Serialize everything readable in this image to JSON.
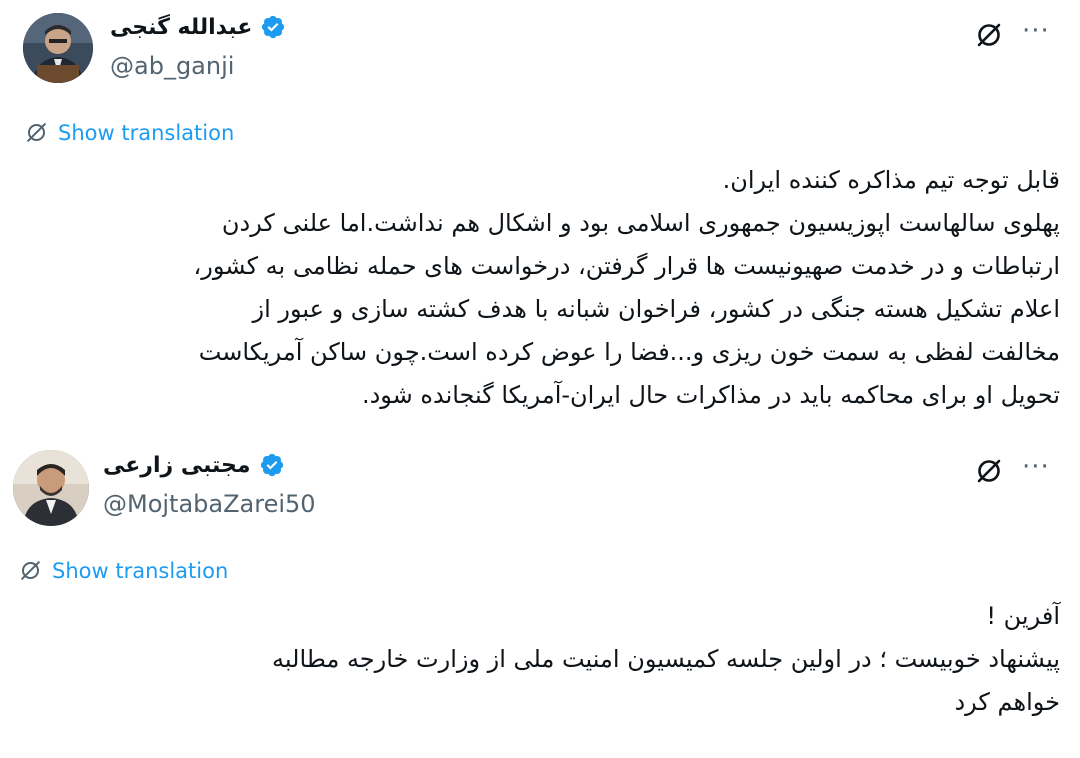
{
  "tweets": [
    {
      "display_name": "عبدالله گنجی",
      "handle": "@ab_ganji",
      "show_translation": "Show translation",
      "more_label": "···",
      "text_lines": [
        "قابل توجه تیم مذاکره کننده ایران.",
        "پهلوی سالهاست اپوزیسیون جمهوری اسلامی بود و اشکال هم نداشت.اما علنی کردن",
        "ارتباطات و در خدمت صهیونیست ها قرار گرفتن، درخواست های حمله نظامی به کشور،",
        "اعلام تشکیل هسته جنگی در کشور، فراخوان شبانه با هدف کشته سازی و عبور از",
        "مخالفت لفظی به سمت خون ریزی و...فضا را عوض کرده است.چون ساکن آمریکاست",
        "تحویل او برای محاکمه باید در مذاکرات حال ایران-آمریکا  گنجانده شود."
      ]
    },
    {
      "display_name": "مجتبی زارعی",
      "handle": "@MojtabaZarei50",
      "show_translation": "Show translation",
      "more_label": "···",
      "text_lines": [
        "آفرین !",
        "پیشنهاد خوبیست ؛ در اولین جلسه کمیسیون امنیت ملی از وزارت خارجه مطالبه",
        "خواهم کرد"
      ]
    }
  ],
  "colors": {
    "link": "#1d9bf0",
    "verified": "#1d9bf0",
    "secondary_text": "#536471",
    "primary_text": "#0f1419"
  },
  "icons": {
    "verified": "verified-badge-icon",
    "grok": "grok-icon",
    "more": "more-options-icon",
    "translate": "translate-icon"
  }
}
